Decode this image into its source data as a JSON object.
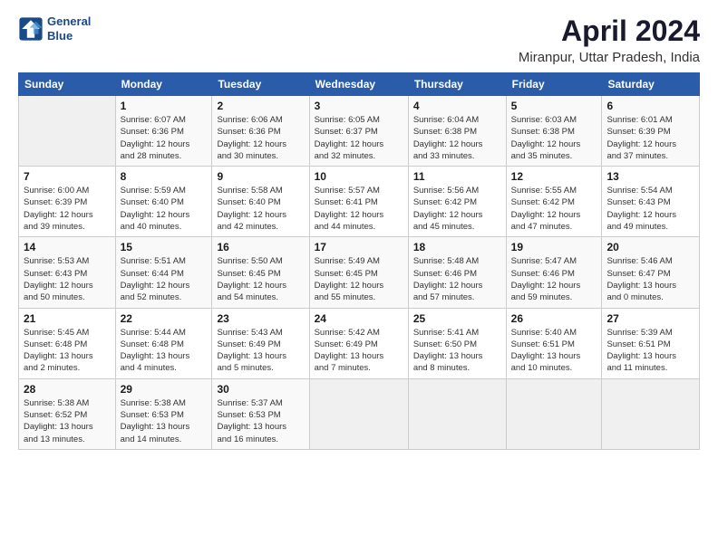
{
  "header": {
    "logo_line1": "General",
    "logo_line2": "Blue",
    "title": "April 2024",
    "subtitle": "Miranpur, Uttar Pradesh, India"
  },
  "columns": [
    "Sunday",
    "Monday",
    "Tuesday",
    "Wednesday",
    "Thursday",
    "Friday",
    "Saturday"
  ],
  "weeks": [
    [
      {
        "day": "",
        "detail": ""
      },
      {
        "day": "1",
        "detail": "Sunrise: 6:07 AM\nSunset: 6:36 PM\nDaylight: 12 hours\nand 28 minutes."
      },
      {
        "day": "2",
        "detail": "Sunrise: 6:06 AM\nSunset: 6:36 PM\nDaylight: 12 hours\nand 30 minutes."
      },
      {
        "day": "3",
        "detail": "Sunrise: 6:05 AM\nSunset: 6:37 PM\nDaylight: 12 hours\nand 32 minutes."
      },
      {
        "day": "4",
        "detail": "Sunrise: 6:04 AM\nSunset: 6:38 PM\nDaylight: 12 hours\nand 33 minutes."
      },
      {
        "day": "5",
        "detail": "Sunrise: 6:03 AM\nSunset: 6:38 PM\nDaylight: 12 hours\nand 35 minutes."
      },
      {
        "day": "6",
        "detail": "Sunrise: 6:01 AM\nSunset: 6:39 PM\nDaylight: 12 hours\nand 37 minutes."
      }
    ],
    [
      {
        "day": "7",
        "detail": "Sunrise: 6:00 AM\nSunset: 6:39 PM\nDaylight: 12 hours\nand 39 minutes."
      },
      {
        "day": "8",
        "detail": "Sunrise: 5:59 AM\nSunset: 6:40 PM\nDaylight: 12 hours\nand 40 minutes."
      },
      {
        "day": "9",
        "detail": "Sunrise: 5:58 AM\nSunset: 6:40 PM\nDaylight: 12 hours\nand 42 minutes."
      },
      {
        "day": "10",
        "detail": "Sunrise: 5:57 AM\nSunset: 6:41 PM\nDaylight: 12 hours\nand 44 minutes."
      },
      {
        "day": "11",
        "detail": "Sunrise: 5:56 AM\nSunset: 6:42 PM\nDaylight: 12 hours\nand 45 minutes."
      },
      {
        "day": "12",
        "detail": "Sunrise: 5:55 AM\nSunset: 6:42 PM\nDaylight: 12 hours\nand 47 minutes."
      },
      {
        "day": "13",
        "detail": "Sunrise: 5:54 AM\nSunset: 6:43 PM\nDaylight: 12 hours\nand 49 minutes."
      }
    ],
    [
      {
        "day": "14",
        "detail": "Sunrise: 5:53 AM\nSunset: 6:43 PM\nDaylight: 12 hours\nand 50 minutes."
      },
      {
        "day": "15",
        "detail": "Sunrise: 5:51 AM\nSunset: 6:44 PM\nDaylight: 12 hours\nand 52 minutes."
      },
      {
        "day": "16",
        "detail": "Sunrise: 5:50 AM\nSunset: 6:45 PM\nDaylight: 12 hours\nand 54 minutes."
      },
      {
        "day": "17",
        "detail": "Sunrise: 5:49 AM\nSunset: 6:45 PM\nDaylight: 12 hours\nand 55 minutes."
      },
      {
        "day": "18",
        "detail": "Sunrise: 5:48 AM\nSunset: 6:46 PM\nDaylight: 12 hours\nand 57 minutes."
      },
      {
        "day": "19",
        "detail": "Sunrise: 5:47 AM\nSunset: 6:46 PM\nDaylight: 12 hours\nand 59 minutes."
      },
      {
        "day": "20",
        "detail": "Sunrise: 5:46 AM\nSunset: 6:47 PM\nDaylight: 13 hours\nand 0 minutes."
      }
    ],
    [
      {
        "day": "21",
        "detail": "Sunrise: 5:45 AM\nSunset: 6:48 PM\nDaylight: 13 hours\nand 2 minutes."
      },
      {
        "day": "22",
        "detail": "Sunrise: 5:44 AM\nSunset: 6:48 PM\nDaylight: 13 hours\nand 4 minutes."
      },
      {
        "day": "23",
        "detail": "Sunrise: 5:43 AM\nSunset: 6:49 PM\nDaylight: 13 hours\nand 5 minutes."
      },
      {
        "day": "24",
        "detail": "Sunrise: 5:42 AM\nSunset: 6:49 PM\nDaylight: 13 hours\nand 7 minutes."
      },
      {
        "day": "25",
        "detail": "Sunrise: 5:41 AM\nSunset: 6:50 PM\nDaylight: 13 hours\nand 8 minutes."
      },
      {
        "day": "26",
        "detail": "Sunrise: 5:40 AM\nSunset: 6:51 PM\nDaylight: 13 hours\nand 10 minutes."
      },
      {
        "day": "27",
        "detail": "Sunrise: 5:39 AM\nSunset: 6:51 PM\nDaylight: 13 hours\nand 11 minutes."
      }
    ],
    [
      {
        "day": "28",
        "detail": "Sunrise: 5:38 AM\nSunset: 6:52 PM\nDaylight: 13 hours\nand 13 minutes."
      },
      {
        "day": "29",
        "detail": "Sunrise: 5:38 AM\nSunset: 6:53 PM\nDaylight: 13 hours\nand 14 minutes."
      },
      {
        "day": "30",
        "detail": "Sunrise: 5:37 AM\nSunset: 6:53 PM\nDaylight: 13 hours\nand 16 minutes."
      },
      {
        "day": "",
        "detail": ""
      },
      {
        "day": "",
        "detail": ""
      },
      {
        "day": "",
        "detail": ""
      },
      {
        "day": "",
        "detail": ""
      }
    ]
  ]
}
